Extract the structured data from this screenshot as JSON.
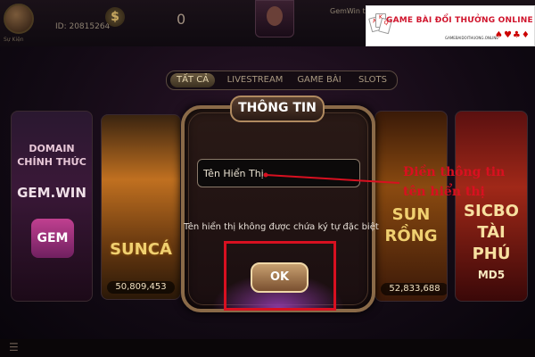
{
  "topbar": {
    "user_id": "ID: 20815264",
    "settings_label": "Sự Kiện",
    "balance": "0",
    "brand_text": "GemWin tự",
    "coin_symbol": "$"
  },
  "watermark": {
    "title": "GAME BÀI ĐỔI THƯỞNG ONLINE",
    "suits": "♠♥♣♦",
    "caption": "GAMEBAIDOITHUONG.ONLINE"
  },
  "tabs": [
    {
      "label": "TẤT CẢ",
      "active": true
    },
    {
      "label": "LIVESTREAM",
      "active": false
    },
    {
      "label": "GAME BÀI",
      "active": false
    },
    {
      "label": "SLOTS",
      "active": false
    }
  ],
  "cards": {
    "domain_text": "DOMAIN CHÍNH THỨC",
    "gemwin_label": "GEM.WIN",
    "gem_logo": "GEM",
    "sunca": {
      "title": "SUNCÁ",
      "jackpot": "50,809,453"
    },
    "sunrong": {
      "title": "SUN RỒNG",
      "jackpot": "52,833,688"
    },
    "sicbo": {
      "title": "SICBO TÀI PHÚ",
      "subtitle": "MD5"
    }
  },
  "modal": {
    "title": "THÔNG TIN",
    "name_field_value": "Tên Hiển Thị",
    "notice": "Tên hiển thị không được chứa ký tự đặc biệt",
    "ok_label": "OK"
  },
  "annotation": {
    "line1": "Điền thông tin",
    "line2": "tên hiển thị",
    "color": "#d81020"
  },
  "colors": {
    "annotation_red": "#d81020",
    "modal_border": "#8a6a48",
    "button_gold": "#c8a070"
  }
}
